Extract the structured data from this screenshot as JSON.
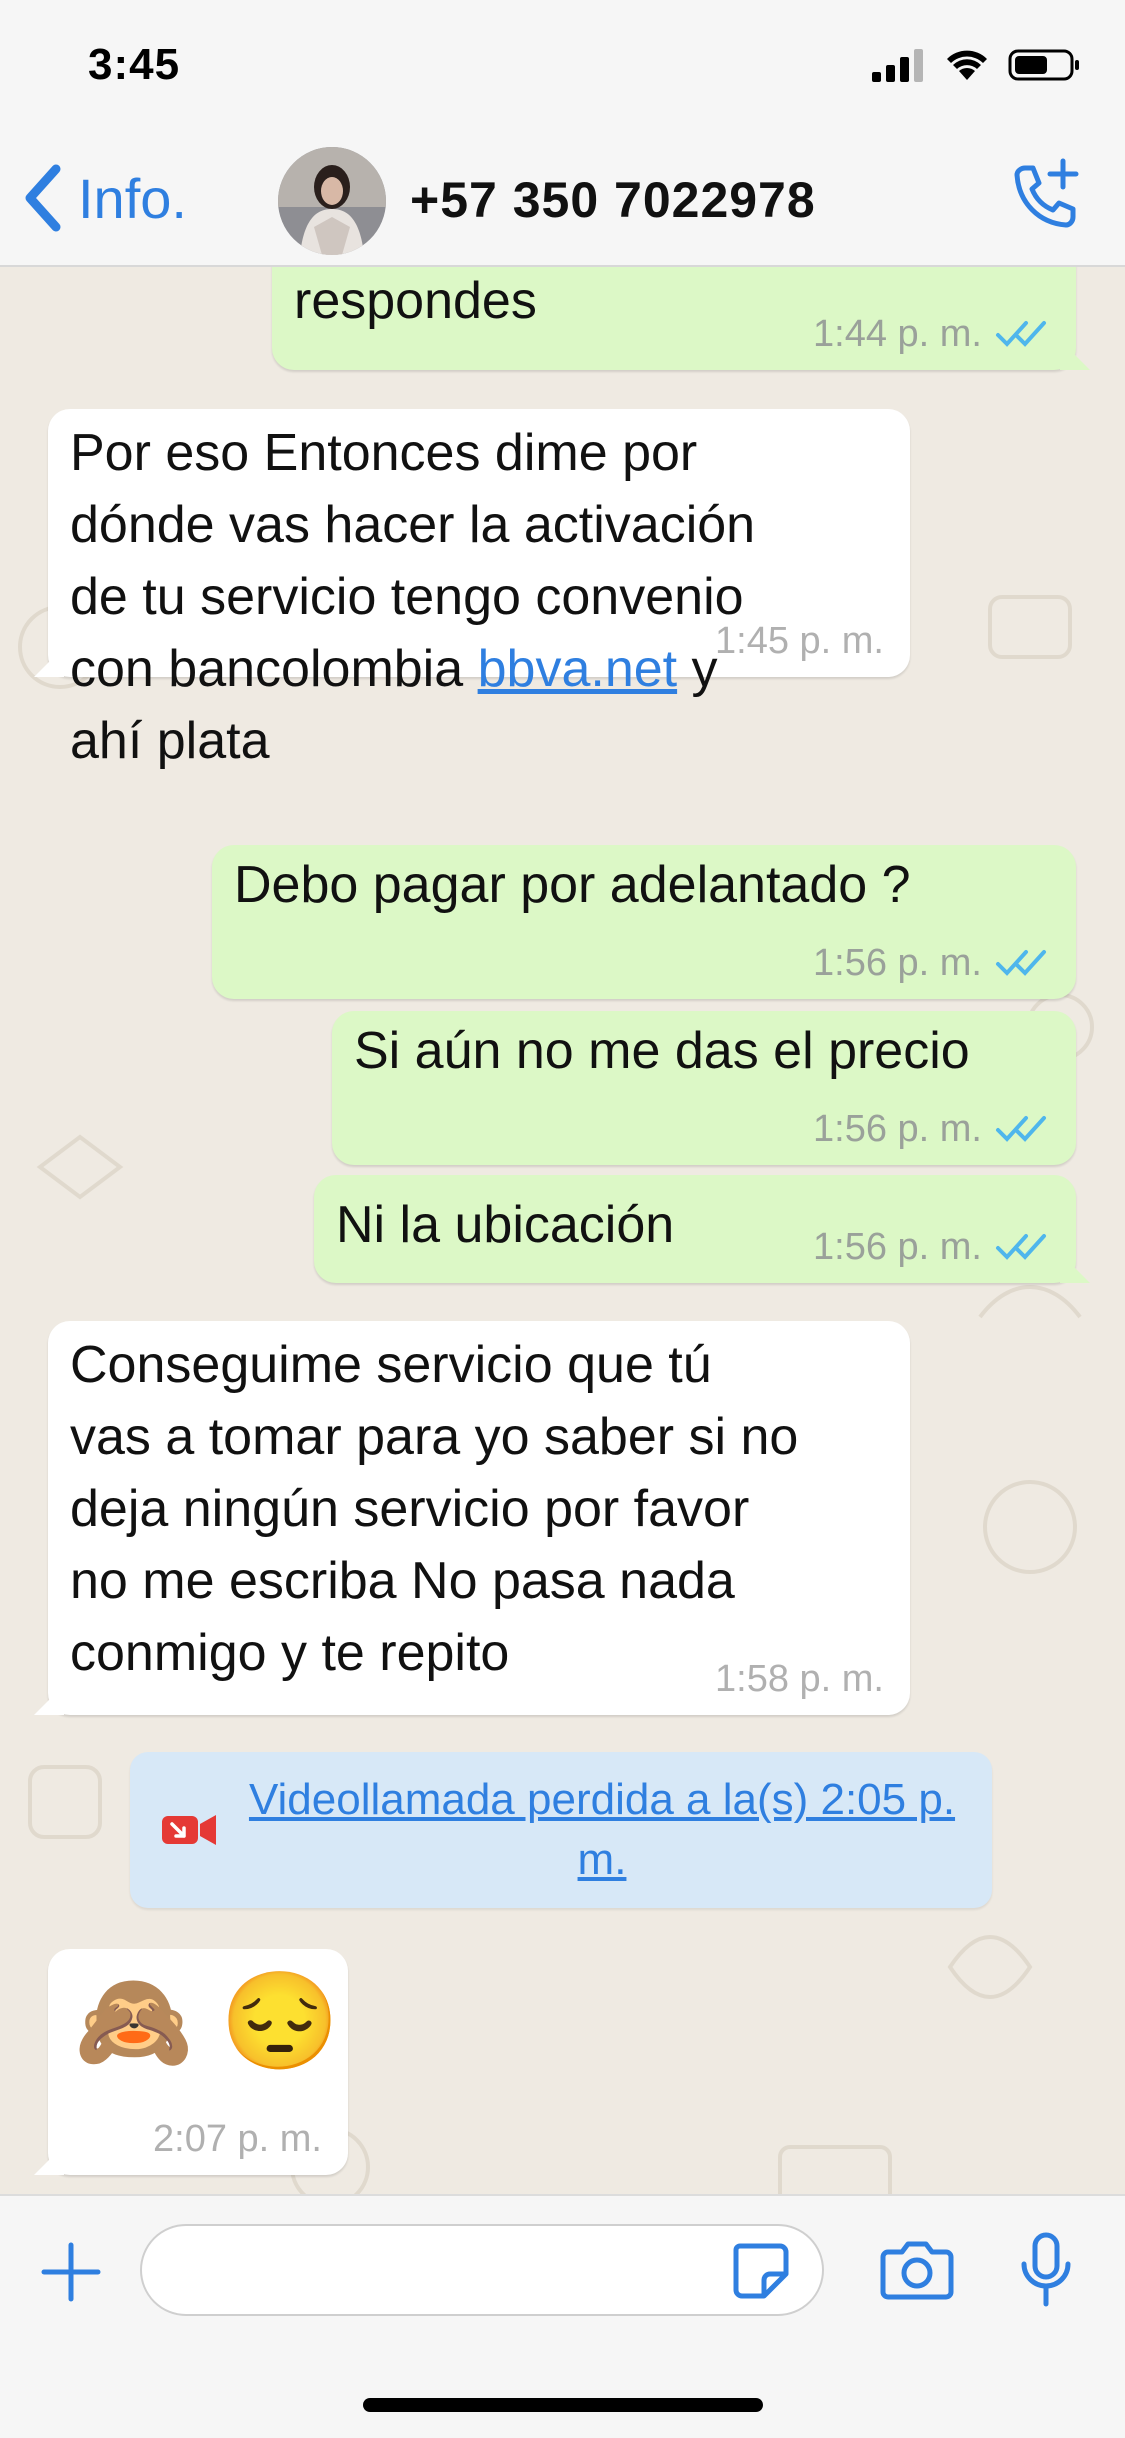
{
  "status_bar": {
    "time": "3:45"
  },
  "header": {
    "back_label": "Info.",
    "contact_name": "+57 350 7022978",
    "icons": {
      "back": "chevron-left-icon",
      "call": "phone-add-icon"
    }
  },
  "colors": {
    "accent": "#2f7fe0",
    "incoming_bubble": "#ffffff",
    "outgoing_bubble": "#dcf8c6",
    "chat_background": "#efeae2",
    "read_ticks": "#4fb6ec",
    "missed_call_banner": "#d7e8f7",
    "missed_call_icon": "#e53935"
  },
  "messages": [
    {
      "direction": "out",
      "text": "responde",
      "time": "1:44 p. m.",
      "status": "read"
    },
    {
      "direction": "in",
      "text_lines": [
        "Por eso Entonces dime por",
        "dónde vas hacer la activación",
        "de tu servicio tengo convenio",
        "con bancolombia ",
        " y",
        "ahí plata"
      ],
      "link": "bbva.net",
      "time": "1:45 p. m."
    },
    {
      "direction": "out",
      "text": "Debo pagar por adelantado ?",
      "time": "1:56 p. m.",
      "status": "read"
    },
    {
      "direction": "out",
      "text": "Si aún no me das el precio",
      "time": "1:56 p. m.",
      "status": "read"
    },
    {
      "direction": "out",
      "text": "Ni la ubicación",
      "time": "1:56 p. m.",
      "status": "read"
    },
    {
      "direction": "in",
      "text_lines": [
        "Conseguime servicio que tú",
        "vas a tomar para yo saber si no",
        "deja ningún servicio por favor",
        "no me escriba No pasa nada",
        "conmigo y te repito"
      ],
      "time": "1:58 p. m."
    },
    {
      "direction": "in",
      "emoji": "🙈 😔",
      "time": "2:07 p. m."
    }
  ],
  "missed_call": {
    "text": "Videollamada perdida a la(s) 2:05 p. m.",
    "icon": "video-camera-missed-icon"
  },
  "composer": {
    "placeholder": "",
    "icons": {
      "add": "plus-icon",
      "sticker": "sticker-icon",
      "camera": "camera-icon",
      "mic": "microphone-icon"
    }
  }
}
